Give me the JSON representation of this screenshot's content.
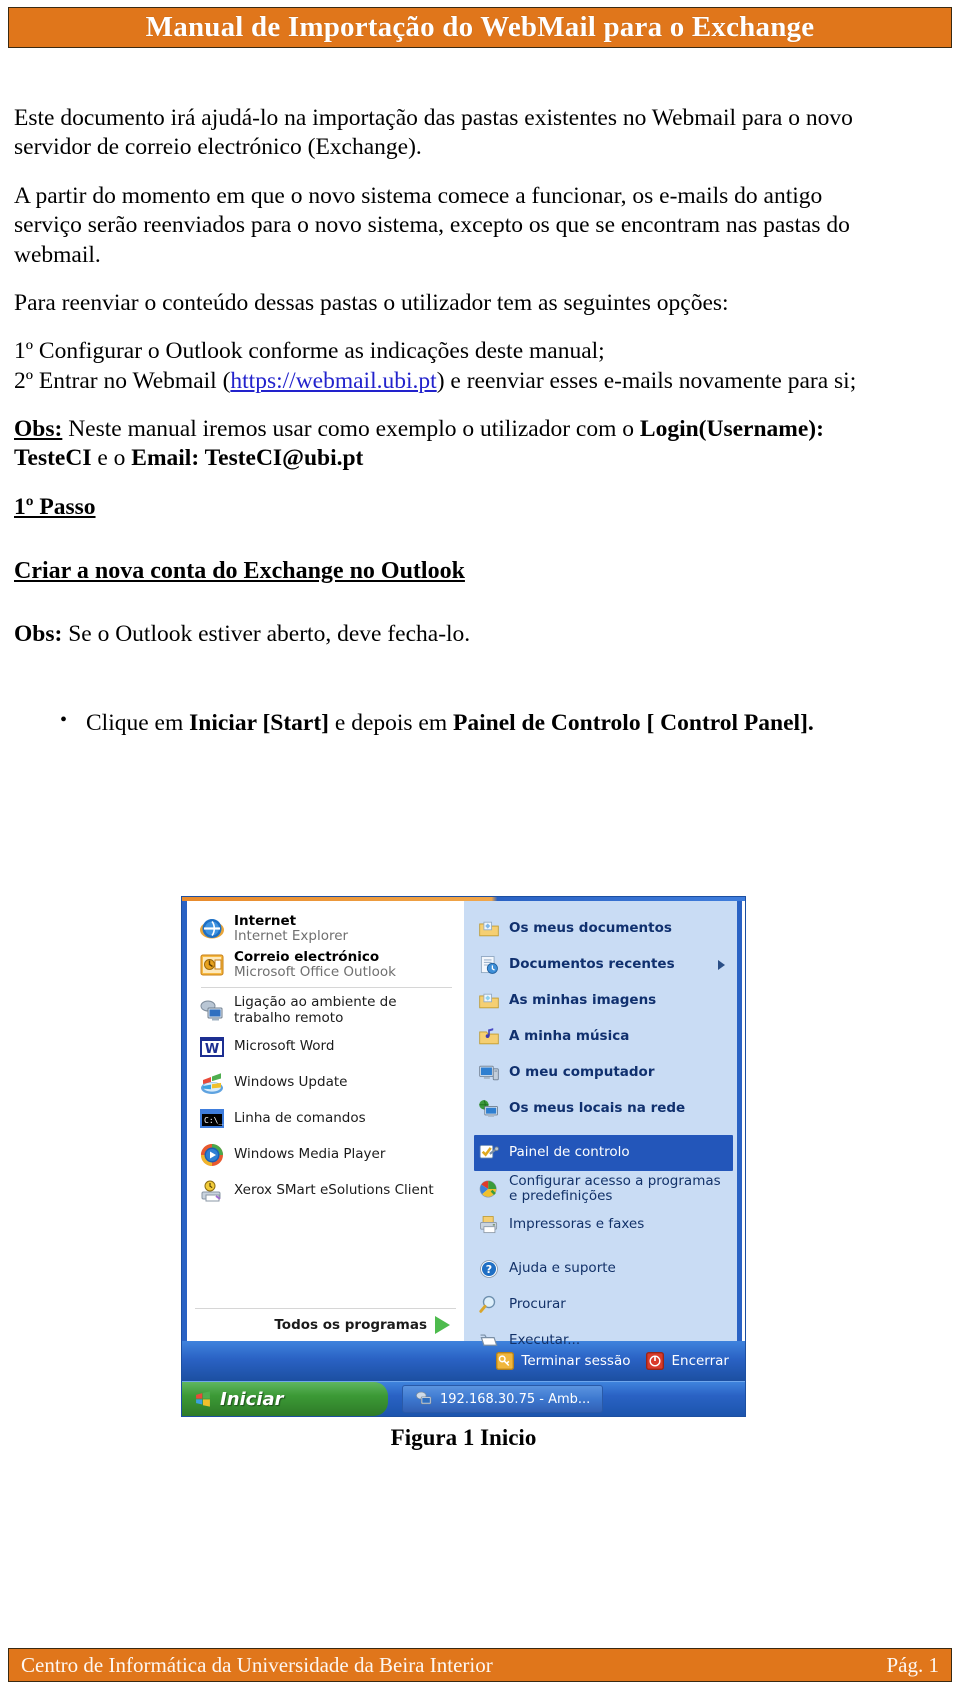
{
  "document": {
    "header_title": "Manual de Importação do WebMail para o Exchange",
    "footer_left": "Centro de Informática da Universidade da Beira Interior",
    "footer_right": "Pág. 1",
    "accent_color": "#E0761B",
    "link_color": "#2222CC"
  },
  "body": {
    "p1": "Este documento irá ajudá-lo na importação das pastas existentes no Webmail para o novo servidor de correio electrónico (Exchange).",
    "p2": "A partir do momento em que o novo sistema comece a funcionar, os e-mails do antigo serviço serão reenviados para o novo sistema, excepto os que se encontram nas pastas do webmail.",
    "p3": "Para reenviar o conteúdo dessas pastas o utilizador tem as seguintes opções:",
    "option1": "1º Configurar o Outlook conforme as indicações deste manual;",
    "option2_before": "2º Entrar no Webmail (",
    "option2_link": "https://webmail.ubi.pt",
    "option2_after": ") e reenviar esses e-mails novamente para si;",
    "obs1_label": "Obs:",
    "obs1_text": " Neste manual iremos usar como exemplo o utilizador com o ",
    "obs1_bold": "Login(Username): TesteCI",
    "obs1_mid": " e o ",
    "obs1_bold2": "Email: TesteCI@ubi.pt",
    "step_heading": "1º Passo",
    "section_heading": "Criar a nova conta  do Exchange no Outlook",
    "obs2_label": "Obs:",
    "obs2_text": " Se  o Outlook estiver aberto, deve fecha-lo.",
    "bullet1_a": "Clique em ",
    "bullet1_b": "Iniciar [Start]",
    "bullet1_c": " e depois em ",
    "bullet1_d": "Painel de Controlo [ Control Panel].",
    "figure_caption": "Figura 1 Inicio"
  },
  "start_menu": {
    "left_pinned": [
      {
        "icon": "internet-explorer-icon",
        "line1": "Internet",
        "line2": "Internet Explorer"
      },
      {
        "icon": "outlook-icon",
        "line1": "Correio electrónico",
        "line2": "Microsoft Office Outlook"
      }
    ],
    "left_items": [
      {
        "icon": "remote-desktop-icon",
        "label": "Ligação ao ambiente de trabalho remoto"
      },
      {
        "icon": "microsoft-word-icon",
        "label": "Microsoft Word"
      },
      {
        "icon": "windows-update-icon",
        "label": "Windows Update"
      },
      {
        "icon": "command-prompt-icon",
        "label": "Linha de comandos"
      },
      {
        "icon": "windows-media-player-icon",
        "label": "Windows Media Player"
      },
      {
        "icon": "xerox-smart-esolutions-icon",
        "label": "Xerox SMart eSolutions Client"
      }
    ],
    "all_programs_label": "Todos os programas",
    "right_items": [
      {
        "icon": "my-documents-icon",
        "label": "Os meus documentos",
        "bold": true,
        "submenu": false,
        "selected": false
      },
      {
        "icon": "recent-documents-icon",
        "label": "Documentos recentes",
        "bold": true,
        "submenu": true,
        "selected": false
      },
      {
        "icon": "my-pictures-icon",
        "label": "As minhas imagens",
        "bold": true,
        "submenu": false,
        "selected": false
      },
      {
        "icon": "my-music-icon",
        "label": "A minha música",
        "bold": true,
        "submenu": false,
        "selected": false
      },
      {
        "icon": "my-computer-icon",
        "label": "O meu computador",
        "bold": true,
        "submenu": false,
        "selected": false
      },
      {
        "icon": "network-places-icon",
        "label": "Os meus locais na rede",
        "bold": true,
        "submenu": false,
        "selected": false
      }
    ],
    "right_items2": [
      {
        "icon": "control-panel-icon",
        "label": "Painel de controlo",
        "selected": true
      },
      {
        "icon": "set-program-access-icon",
        "label": "Configurar acesso a programas e predefinições",
        "selected": false
      },
      {
        "icon": "printers-faxes-icon",
        "label": "Impressoras e faxes",
        "selected": false
      }
    ],
    "right_items3": [
      {
        "icon": "help-support-icon",
        "label": "Ajuda e suporte"
      },
      {
        "icon": "search-icon",
        "label": "Procurar"
      },
      {
        "icon": "run-icon",
        "label": "Executar..."
      }
    ],
    "logoff_label": "Terminar sessão",
    "shutdown_label": "Encerrar",
    "start_button_label": "Iniciar",
    "taskbar_item": "192.168.30.75 - Amb..."
  }
}
